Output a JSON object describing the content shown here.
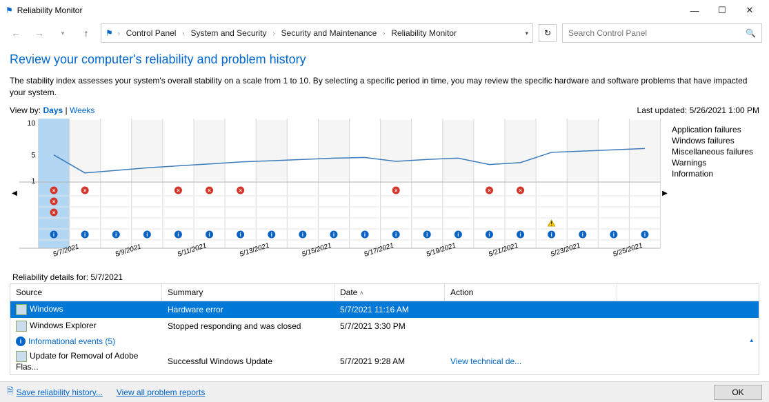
{
  "window": {
    "title": "Reliability Monitor"
  },
  "breadcrumb": [
    "Control Panel",
    "System and Security",
    "Security and Maintenance",
    "Reliability Monitor"
  ],
  "search": {
    "placeholder": "Search Control Panel"
  },
  "heading": "Review your computer's reliability and problem history",
  "description": "The stability index assesses your system's overall stability on a scale from 1 to 10. By selecting a specific period in time, you may review the specific hardware and software problems that have impacted your system.",
  "view": {
    "label": "View by:",
    "days": "Days",
    "weeks": "Weeks"
  },
  "lastupdated": "Last updated: 5/26/2021 1:00 PM",
  "legend": [
    "Application failures",
    "Windows failures",
    "Miscellaneous failures",
    "Warnings",
    "Information"
  ],
  "chart_data": {
    "type": "line",
    "title": "",
    "xlabel": "",
    "ylabel": "",
    "ylim": [
      1,
      10
    ],
    "yticks": [
      1,
      5,
      10
    ],
    "categories": [
      "5/7/2021",
      "5/8/2021",
      "5/9/2021",
      "5/10/2021",
      "5/11/2021",
      "5/12/2021",
      "5/13/2021",
      "5/14/2021",
      "5/15/2021",
      "5/16/2021",
      "5/17/2021",
      "5/18/2021",
      "5/19/2021",
      "5/20/2021",
      "5/21/2021",
      "5/22/2021",
      "5/23/2021",
      "5/24/2021",
      "5/25/2021",
      "5/26/2021"
    ],
    "xticklabels_shown": [
      "5/7/2021",
      "5/9/2021",
      "5/11/2021",
      "5/13/2021",
      "5/15/2021",
      "5/17/2021",
      "5/19/2021",
      "5/21/2021",
      "5/23/2021",
      "5/25/2021"
    ],
    "values": [
      5.0,
      2.2,
      2.6,
      3.0,
      3.3,
      3.6,
      3.9,
      4.1,
      4.3,
      4.5,
      4.6,
      4.0,
      4.3,
      4.5,
      3.5,
      3.8,
      5.4,
      5.6,
      5.8,
      6.0
    ],
    "selected_index": 0,
    "events": {
      "application_failures": [
        0,
        1,
        4,
        5,
        6,
        11,
        14,
        15
      ],
      "windows_failures": [
        0
      ],
      "misc_failures": [
        0
      ],
      "warnings": [
        16
      ],
      "information": [
        0,
        1,
        2,
        3,
        4,
        5,
        6,
        7,
        8,
        9,
        10,
        11,
        12,
        13,
        14,
        15,
        16,
        17,
        18,
        19
      ]
    }
  },
  "details": {
    "label": "Reliability details for: 5/7/2021",
    "columns": [
      "Source",
      "Summary",
      "Date",
      "Action"
    ],
    "rows": [
      {
        "source": "Windows",
        "summary": "Hardware error",
        "date": "5/7/2021 11:16 AM",
        "action": "",
        "selected": true
      },
      {
        "source": "Windows Explorer",
        "summary": "Stopped responding and was closed",
        "date": "5/7/2021 3:30 PM",
        "action": ""
      }
    ],
    "info_group": "Informational events (5)",
    "info_rows": [
      {
        "source": "Update for Removal of Adobe Flas...",
        "summary": "Successful Windows Update",
        "date": "5/7/2021 9:28 AM",
        "action": "View technical de..."
      }
    ]
  },
  "footer": {
    "save": "Save reliability history...",
    "viewall": "View all problem reports",
    "ok": "OK"
  }
}
